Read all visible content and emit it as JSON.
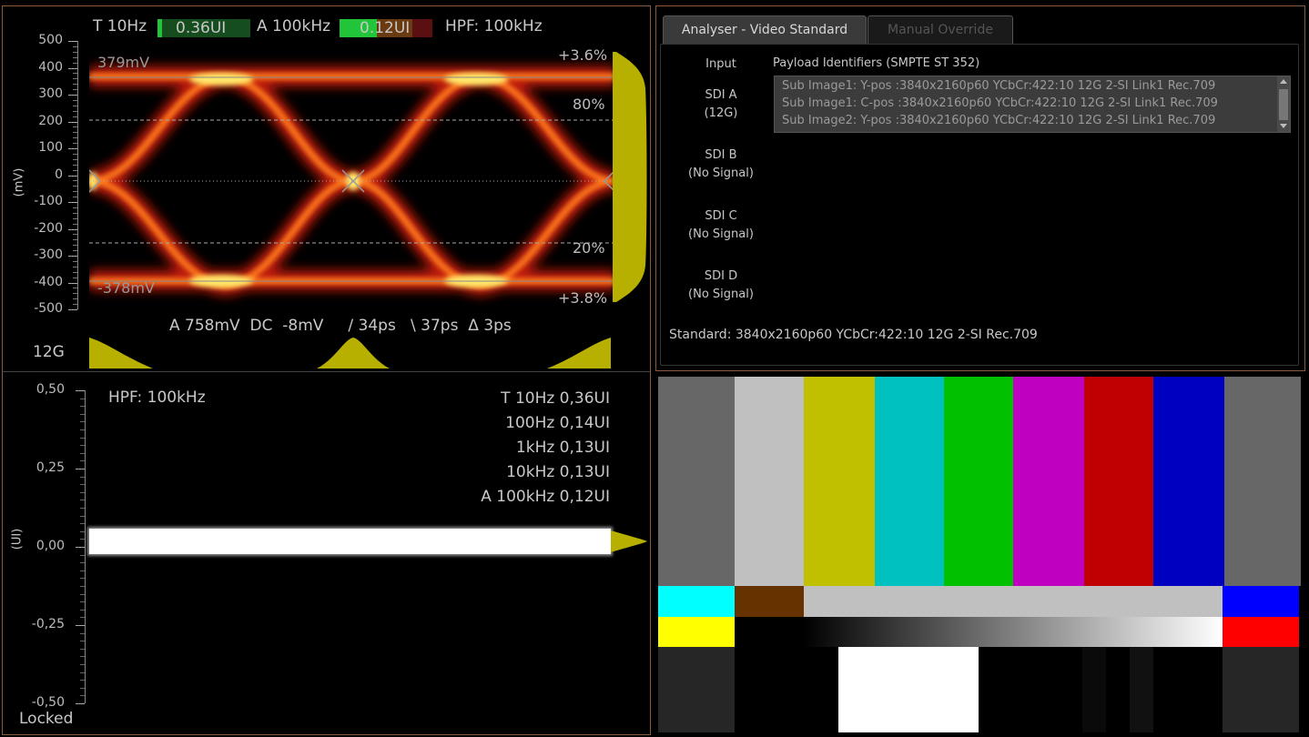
{
  "eye": {
    "top": {
      "t_freq": "T 10Hz",
      "t_value": "0.36UI",
      "a_freq": "A 100kHz",
      "a_value": "0.12UI",
      "hpf": "HPF: 100kHz",
      "t_meter_fill": 0.05,
      "a_meter_fill": 0.4
    },
    "y_axis_label": "(mV)",
    "y_ticks": [
      "500",
      "400",
      "300",
      "200",
      "100",
      "0",
      "-100",
      "-200",
      "-300",
      "-400",
      "-500"
    ],
    "upper_level": "379mV",
    "lower_level": "-378mV",
    "overshoot_top": "+3.6%",
    "pct_80": "80%",
    "pct_20": "20%",
    "overshoot_bottom": "+3.8%",
    "measurements": "A 758mV  DC  -8mV     / 34ps   \\ 37ps  Δ 3ps",
    "rate": "12G"
  },
  "jitter": {
    "hpf": "HPF: 100kHz",
    "y_axis_label": "(UI)",
    "y_ticks": [
      "0,50",
      "0,25",
      "0,00",
      "-0,25",
      "-0,50"
    ],
    "readings": [
      "T 10Hz 0,36UI",
      "100Hz 0,14UI",
      "1kHz 0,13UI",
      "10kHz 0,13UI",
      "A 100kHz 0,12UI"
    ],
    "status": "Locked"
  },
  "analyser": {
    "tabs": [
      {
        "label": "Analyser - Video Standard",
        "active": true
      },
      {
        "label": "Manual Override",
        "active": false
      }
    ],
    "col_input": "Input",
    "col_payload": "Payload Identifiers (SMPTE ST 352)",
    "inputs": [
      {
        "name": "SDI A",
        "status": "(12G)"
      },
      {
        "name": "SDI B",
        "status": "(No Signal)"
      },
      {
        "name": "SDI C",
        "status": "(No Signal)"
      },
      {
        "name": "SDI D",
        "status": "(No Signal)"
      }
    ],
    "payloads": [
      "Sub Image1: Y-pos :3840x2160p60 YCbCr:422:10 12G 2-SI Link1 Rec.709",
      "Sub Image1: C-pos :3840x2160p60 YCbCr:422:10 12G 2-SI Link1 Rec.709",
      "Sub Image2: Y-pos :3840x2160p60 YCbCr:422:10 12G 2-SI Link1 Rec.709"
    ],
    "standard": "Standard: 3840x2160p60 YCbCr:422:10 12G 2-SI Rec.709"
  },
  "colors": {
    "panel_border": "#8a5a3a",
    "histogram": "#b8b000",
    "meter_green": "#22c43a",
    "meter_red": "#6a1010",
    "bars_top": [
      "#676767",
      "#c0c0c0",
      "#c0c000",
      "#00c0c0",
      "#00c000",
      "#c000c0",
      "#c00000",
      "#0000c0",
      "#676767"
    ],
    "bars_mid_left": "#00ffff",
    "bars_mid_2": "#663300",
    "bars_mid_gray": "#c0c0c0",
    "bars_mid_right": "#0000ff",
    "bars_low_left": "#ffff00",
    "bars_low_right": "#ff0000"
  }
}
